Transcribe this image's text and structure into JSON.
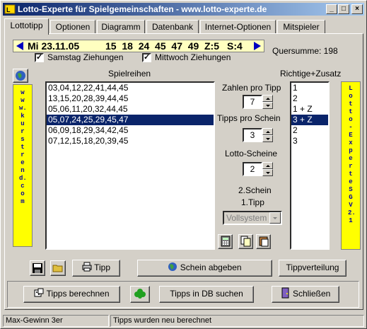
{
  "window": {
    "title": "Lotto-Experte für Spielgemeinschaften - www.lotto-experte.de"
  },
  "tabs": [
    "Lottotipp",
    "Optionen",
    "Diagramm",
    "Datenbank",
    "Internet-Optionen",
    "Mitspieler"
  ],
  "draw": {
    "date": "Mi 23.11.05",
    "numbers": "15  18  24  45  47  49",
    "zusatz": "Z:5",
    "super": "S:4",
    "quersumme": "Quersumme: 198",
    "saturday_label": "Samstag Ziehungen",
    "wednesday_label": "Mittwoch Ziehungen",
    "saturday_checked": true,
    "wednesday_checked": true
  },
  "spielreihen": {
    "label": "Spielreihen",
    "rows": [
      "03,04,12,22,41,44,45",
      "13,15,20,28,39,44,45",
      "05,06,11,20,32,44,45",
      "05,07,24,25,29,45,47",
      "06,09,18,29,34,42,45",
      "07,12,15,18,20,39,45"
    ],
    "selected_index": 3
  },
  "richtige": {
    "label": "Richtige+Zusatz",
    "rows": [
      "1",
      "2",
      "1 + Z",
      "3 + Z",
      "2",
      "3"
    ],
    "selected_index": 3
  },
  "settings": {
    "zahlen_label": "Zahlen pro Tipp",
    "zahlen_value": "7",
    "tipps_label": "Tipps pro Schein",
    "tipps_value": "3",
    "scheine_label": "Lotto-Scheine",
    "scheine_value": "2",
    "schein_info": "2.Schein",
    "tipp_info": "1.Tipp",
    "system_select": "Vollsystem"
  },
  "banners": {
    "left": "www.kurstrend.com",
    "right": "Lotto-Experte SG V2.1"
  },
  "buttons": {
    "tipp": "Tipp",
    "schein_abgeben": "Schein abgeben",
    "tippverteilung": "Tippverteilung",
    "tipps_berechnen": "Tipps berechnen",
    "tipps_db": "Tipps in DB suchen",
    "schliessen": "Schließen"
  },
  "status": {
    "left": "Max-Gewinn 3er",
    "right": "Tipps wurden neu berechnet"
  }
}
